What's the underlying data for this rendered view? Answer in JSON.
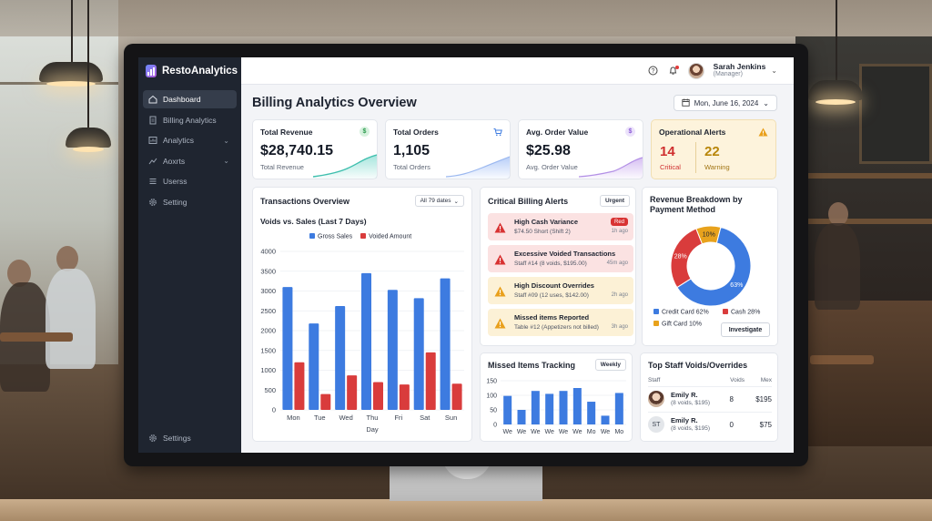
{
  "app": {
    "name": "RestoAnalytics"
  },
  "sidebar": {
    "items": [
      {
        "label": "Dashboard"
      },
      {
        "label": "Billing Analytics"
      },
      {
        "label": "Analytics"
      },
      {
        "label": "Aoxrts"
      },
      {
        "label": "Userss"
      },
      {
        "label": "Setting"
      }
    ],
    "bottom_label": "Settings"
  },
  "user": {
    "name": "Sarah Jenkins",
    "role": "(Manager)"
  },
  "page": {
    "title": "Billing Analytics Overview",
    "date": "Mon, June 16, 2024"
  },
  "kpis": {
    "revenue": {
      "title": "Total Revenue",
      "value": "$28,740.15",
      "sub": "Total Revenue",
      "icon": "$"
    },
    "orders": {
      "title": "Total Orders",
      "value": "1,105",
      "sub": "Total Orders"
    },
    "aov": {
      "title": "Avg. Order Value",
      "value": "$25.98",
      "sub": "Avg. Order Value",
      "icon": "$"
    },
    "alerts": {
      "title": "Operational Alerts",
      "critical_count": "14",
      "critical_label": "Critical",
      "warning_count": "22",
      "warning_label": "Warning"
    }
  },
  "transactions": {
    "title": "Transactions Overview",
    "filter": "All 79 dates",
    "chart_title": "Voids vs. Sales (Last 7 Days)"
  },
  "chart_data": [
    {
      "type": "bar",
      "title": "Voids vs. Sales (Last 7 Days)",
      "categories": [
        "Mon",
        "Tue",
        "Wed",
        "Thu",
        "Fri",
        "Sat",
        "Sun"
      ],
      "series": [
        {
          "name": "Gross Sales",
          "values": [
            3100,
            2180,
            2620,
            3450,
            3030,
            2820,
            3320
          ],
          "color": "#3d7be0"
        },
        {
          "name": "Voided Amount",
          "values": [
            1200,
            400,
            870,
            700,
            640,
            1450,
            660
          ],
          "color": "#d93c3c"
        }
      ],
      "xlabel": "Day",
      "ylabel": "",
      "yticks": [
        "0",
        "500",
        "1000",
        "1500",
        "2000",
        "2500",
        "3000",
        "3500",
        "4000"
      ],
      "ylim": [
        0,
        4000
      ],
      "legend": "top"
    },
    {
      "type": "pie",
      "title": "Revenue Breakdown by Payment Method",
      "labels": [
        "Credit Card",
        "Cash",
        "Gift Card"
      ],
      "values": [
        62,
        28,
        10
      ],
      "value_labels": [
        "63%",
        "28%",
        "10%"
      ],
      "colors": [
        "#3d7be0",
        "#d93c3c",
        "#e8a21c"
      ]
    },
    {
      "type": "bar",
      "title": "Missed Items Tracking",
      "categories": [
        "We",
        "We",
        "We",
        "We",
        "We",
        "We",
        "Mo",
        "We",
        "Mo"
      ],
      "values": [
        98,
        50,
        115,
        105,
        115,
        125,
        78,
        30,
        108
      ],
      "yticks": [
        "0",
        "50",
        "100",
        "150"
      ],
      "ylim": [
        0,
        150
      ],
      "colors": [
        "#3d7be0"
      ]
    }
  ],
  "billing_alerts": {
    "title": "Critical Billing Alerts",
    "badge": "Urgent",
    "items": [
      {
        "title": "High Cash Variance",
        "detail": "$74.50 Short (Shift 2)",
        "time": "1h ago",
        "tag": "Red",
        "level": "red"
      },
      {
        "title": "Excessive Voided Transactions",
        "detail": "Staff #14 (8 voids, $195.00)",
        "time": "45m ago",
        "level": "red"
      },
      {
        "title": "High Discount Overrides",
        "detail": "Staff #09 (12 uses, $142.00)",
        "time": "2h ago",
        "level": "yellow"
      },
      {
        "title": "Missed items Reported",
        "detail": "Table #12 (Appetizers not billed)",
        "time": "3h ago",
        "level": "yellow"
      }
    ]
  },
  "revenue_breakdown": {
    "title_line1": "Revenue Breakdown by",
    "title_line2": "Payment Method",
    "legend": [
      {
        "label": "Credit Card 62%"
      },
      {
        "label": "Cash 28%"
      },
      {
        "label": "Gift Card 10%"
      }
    ],
    "button": "Investigate"
  },
  "missed_items": {
    "title": "Missed Items Tracking",
    "filter": "Weekly"
  },
  "top_staff": {
    "title": "Top Staff Voids/Overrides",
    "columns": [
      "Staff",
      "Voids",
      "Mex"
    ],
    "rows": [
      {
        "name": "Emily R.",
        "sub": "(8 voids, $195)",
        "voids": "8",
        "amount": "$195",
        "initials": ""
      },
      {
        "name": "Emily R.",
        "sub": "(8 voids, $195)",
        "voids": "0",
        "amount": "$75",
        "initials": "ST"
      }
    ]
  }
}
